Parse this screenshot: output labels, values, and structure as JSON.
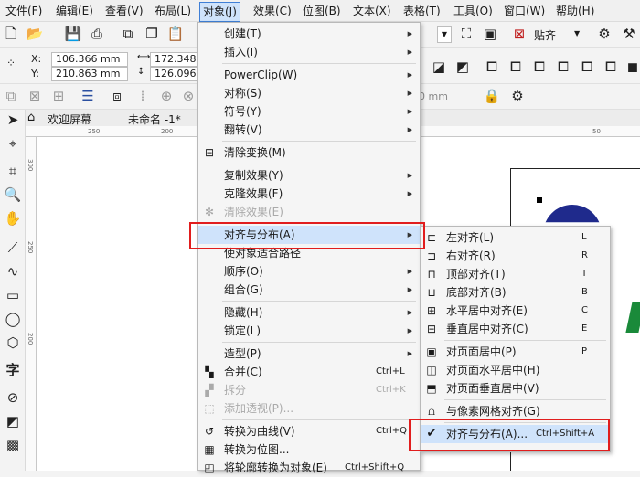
{
  "menubar": [
    {
      "label": "文件(F)"
    },
    {
      "label": "编辑(E)"
    },
    {
      "label": "查看(V)"
    },
    {
      "label": "布局(L)"
    },
    {
      "label": "对象(J)"
    },
    {
      "label": "效果(C)"
    },
    {
      "label": "位图(B)"
    },
    {
      "label": "文本(X)"
    },
    {
      "label": "表格(T)"
    },
    {
      "label": "工具(O)"
    },
    {
      "label": "窗口(W)"
    },
    {
      "label": "帮助(H)"
    }
  ],
  "toolbar": {
    "snap_label": "贴齐"
  },
  "propbar": {
    "x_label": "X:",
    "y_label": "Y:",
    "x_value": "106.366 mm",
    "y_value": "210.863 mm",
    "w_value": "172.348 m",
    "h_value": "126.096 m",
    "mm_text": "0 mm"
  },
  "tabs": {
    "welcome": "欢迎屏幕",
    "doc": "未命名 -1*"
  },
  "ruler": {
    "top": [
      "250",
      "200",
      "50"
    ],
    "left": [
      "300",
      "250",
      "200"
    ]
  },
  "object_menu": [
    {
      "label": "创建(T)",
      "arrow": true
    },
    {
      "label": "插入(I)",
      "arrow": true
    },
    {
      "sep": true
    },
    {
      "label": "PowerClip(W)",
      "arrow": true
    },
    {
      "label": "对称(S)",
      "arrow": true
    },
    {
      "label": "符号(Y)",
      "arrow": true
    },
    {
      "label": "翻转(V)",
      "arrow": true
    },
    {
      "sep": true
    },
    {
      "label": "清除变换(M)",
      "icon": "clear-transform"
    },
    {
      "sep": true
    },
    {
      "label": "复制效果(Y)",
      "arrow": true
    },
    {
      "label": "克隆效果(F)",
      "arrow": true
    },
    {
      "label": "清除效果(E)",
      "disabled": true,
      "icon": "clear-effect"
    },
    {
      "sep": true
    },
    {
      "label": "对齐与分布(A)",
      "arrow": true,
      "active": true
    },
    {
      "label": "使对象适合路径"
    },
    {
      "label": "顺序(O)",
      "arrow": true
    },
    {
      "label": "组合(G)",
      "arrow": true
    },
    {
      "sep": true
    },
    {
      "label": "隐藏(H)",
      "arrow": true
    },
    {
      "label": "锁定(L)",
      "arrow": true
    },
    {
      "sep": true
    },
    {
      "label": "造型(P)",
      "arrow": true
    },
    {
      "label": "合并(C)",
      "shortcut": "Ctrl+L",
      "icon": "combine"
    },
    {
      "label": "拆分",
      "shortcut": "Ctrl+K",
      "disabled": true,
      "icon": "break"
    },
    {
      "label": "添加透视(P)...",
      "disabled": true,
      "icon": "perspective"
    },
    {
      "sep": true
    },
    {
      "label": "转换为曲线(V)",
      "shortcut": "Ctrl+Q",
      "icon": "convert-curve"
    },
    {
      "label": "转换为位图...",
      "icon": "convert-bitmap"
    },
    {
      "label": "将轮廓转换为对象(E)",
      "shortcut": "Ctrl+Shift+Q",
      "icon": "outline-object"
    }
  ],
  "align_menu": [
    {
      "label": "左对齐(L)",
      "shortcut": "L",
      "icon": "align-left"
    },
    {
      "label": "右对齐(R)",
      "shortcut": "R",
      "icon": "align-right"
    },
    {
      "label": "顶部对齐(T)",
      "shortcut": "T",
      "icon": "align-top"
    },
    {
      "label": "底部对齐(B)",
      "shortcut": "B",
      "icon": "align-bottom"
    },
    {
      "label": "水平居中对齐(E)",
      "shortcut": "C",
      "icon": "align-hcenter"
    },
    {
      "label": "垂直居中对齐(C)",
      "shortcut": "E",
      "icon": "align-vcenter"
    },
    {
      "sep": true
    },
    {
      "label": "对页面居中(P)",
      "shortcut": "P",
      "icon": "page-center"
    },
    {
      "label": "对页面水平居中(H)",
      "icon": "page-hcenter"
    },
    {
      "label": "对页面垂直居中(V)",
      "icon": "page-vcenter"
    },
    {
      "sep": true
    },
    {
      "label": "与像素网格对齐(G)",
      "icon": "pixel-grid"
    },
    {
      "sep": true
    },
    {
      "label": "对齐与分布(A)...",
      "shortcut": "Ctrl+Shift+A",
      "checked": true,
      "active": true
    }
  ],
  "colors": {
    "accent": "#3f7fd6",
    "highlight": "#cfe3fb",
    "callout": "#e11d1d",
    "circle": "#1f2a8c",
    "green": "#1a8a3a"
  }
}
